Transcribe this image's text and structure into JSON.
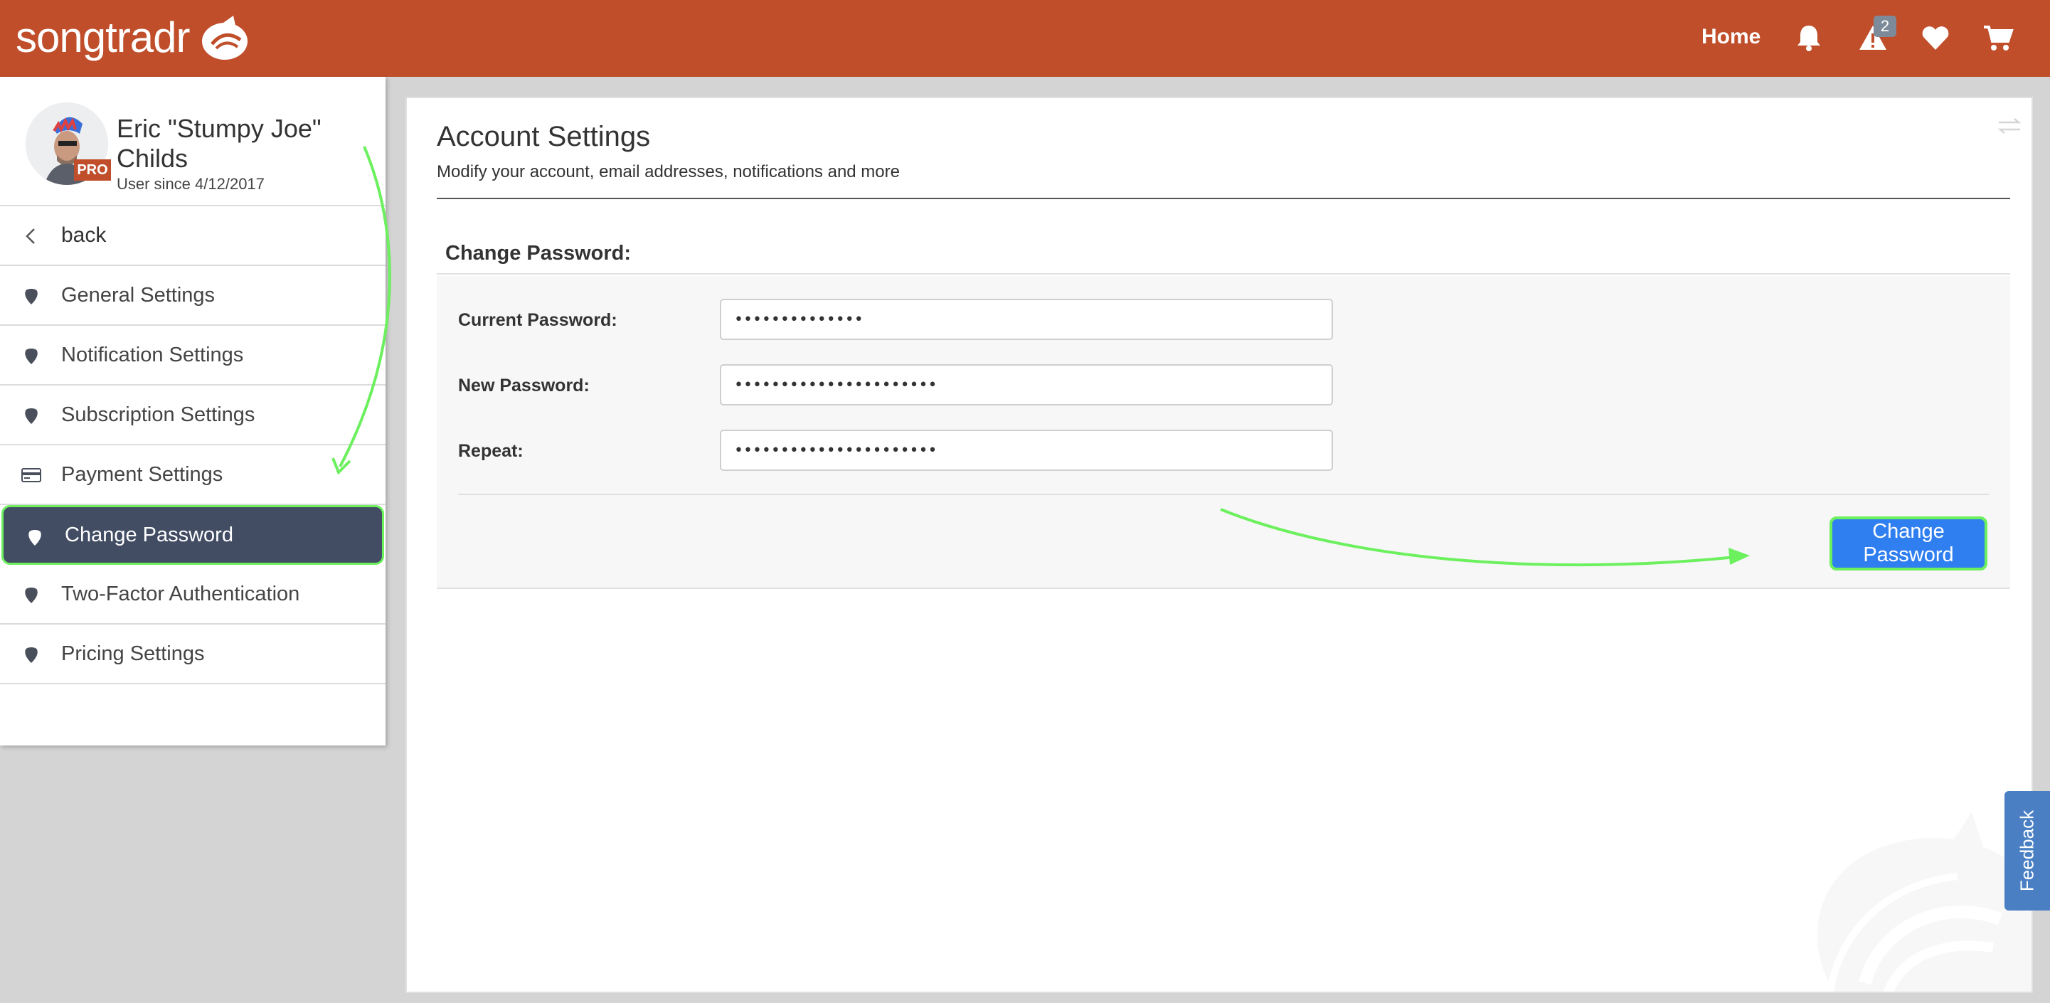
{
  "app": {
    "logo_text": "songtradr"
  },
  "topnav": {
    "home_label": "Home",
    "alert_count": "2"
  },
  "profile": {
    "name": "Eric \"Stumpy Joe\" Childs",
    "badge": "PRO",
    "since": "User since 4/12/2017"
  },
  "sidebar": {
    "back_label": "back",
    "items": [
      {
        "label": "General Settings",
        "icon": "pick-icon"
      },
      {
        "label": "Notification Settings",
        "icon": "pick-icon"
      },
      {
        "label": "Subscription Settings",
        "icon": "pick-icon"
      },
      {
        "label": "Payment Settings",
        "icon": "credit-card-icon"
      },
      {
        "label": "Change Password",
        "icon": "pick-icon",
        "active": true
      },
      {
        "label": "Two-Factor Authentication",
        "icon": "pick-icon"
      },
      {
        "label": "Pricing Settings",
        "icon": "pick-icon"
      }
    ]
  },
  "main": {
    "title": "Account Settings",
    "subtitle": "Modify your account, email addresses, notifications and more",
    "section_title": "Change Password:",
    "fields": {
      "current": {
        "label": "Current Password:",
        "value": "••••••••••••••"
      },
      "new": {
        "label": "New Password:",
        "value": "••••••••••••••••••••••"
      },
      "repeat": {
        "label": "Repeat:",
        "value": "••••••••••••••••••••••"
      }
    },
    "submit_label": "Change Password"
  },
  "feedback_label": "Feedback",
  "colors": {
    "brand": "#c04e2b",
    "active_nav": "#424d64",
    "button": "#2f7ff0",
    "annotation": "#6cf05e"
  }
}
